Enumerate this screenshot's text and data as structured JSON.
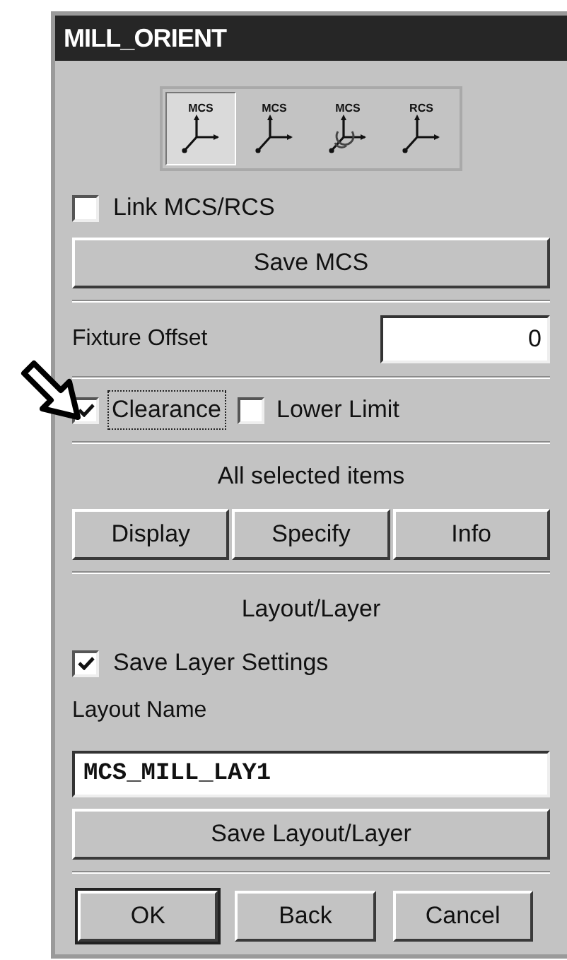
{
  "window": {
    "title": "MILL_ORIENT"
  },
  "orientation_tools": [
    {
      "label": "MCS",
      "kind": "axes",
      "selected": true
    },
    {
      "label": "MCS",
      "kind": "axes",
      "selected": false
    },
    {
      "label": "MCS",
      "kind": "rotate",
      "selected": false
    },
    {
      "label": "RCS",
      "kind": "axes",
      "selected": false
    }
  ],
  "link_checkbox": {
    "label": "Link MCS/RCS",
    "checked": false
  },
  "save_mcs_button": "Save MCS",
  "fixture_offset": {
    "label": "Fixture Offset",
    "value": "0"
  },
  "limits": [
    {
      "label": "Clearance",
      "checked": true,
      "focused": true
    },
    {
      "label": "Lower Limit",
      "checked": false,
      "focused": false
    }
  ],
  "selected_items": {
    "heading": "All selected items",
    "buttons": [
      "Display",
      "Specify",
      "Info"
    ]
  },
  "layout_layer": {
    "heading": "Layout/Layer",
    "save_settings": {
      "label": "Save Layer Settings",
      "checked": true
    },
    "name_label": "Layout Name",
    "name_value": "MCS_MILL_LAY1",
    "save_button": "Save Layout/Layer"
  },
  "buttons": [
    {
      "label": "OK",
      "default": true
    },
    {
      "label": "Back",
      "default": false
    },
    {
      "label": "Cancel",
      "default": false
    }
  ]
}
